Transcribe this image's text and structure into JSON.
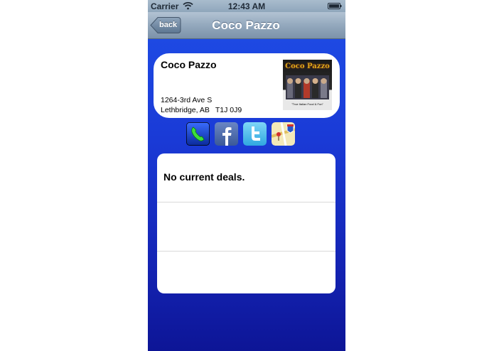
{
  "status_bar": {
    "carrier": "Carrier",
    "time": "12:43 AM",
    "wifi_icon": "wifi-icon",
    "battery_icon": "battery-icon"
  },
  "nav_bar": {
    "back_label": "back",
    "title": "Coco Pazzo"
  },
  "business": {
    "name": "Coco Pazzo",
    "address_line1": "1264-3rd Ave S",
    "city": "Lethbridge, AB",
    "postal_code": "T1J 0J9",
    "logo": {
      "title": "Coco Pazzo",
      "tagline": "\"True Italian Food & Fun\""
    }
  },
  "actions": [
    {
      "name": "phone-icon"
    },
    {
      "name": "facebook-icon"
    },
    {
      "name": "twitter-icon"
    },
    {
      "name": "maps-icon"
    }
  ],
  "deals": {
    "rows": [
      "No current deals.",
      "",
      ""
    ]
  },
  "colors": {
    "background_top": "#1f4fe8",
    "background_bottom": "#0d1596",
    "navbar": "#93a8bd",
    "card": "#ffffff"
  }
}
